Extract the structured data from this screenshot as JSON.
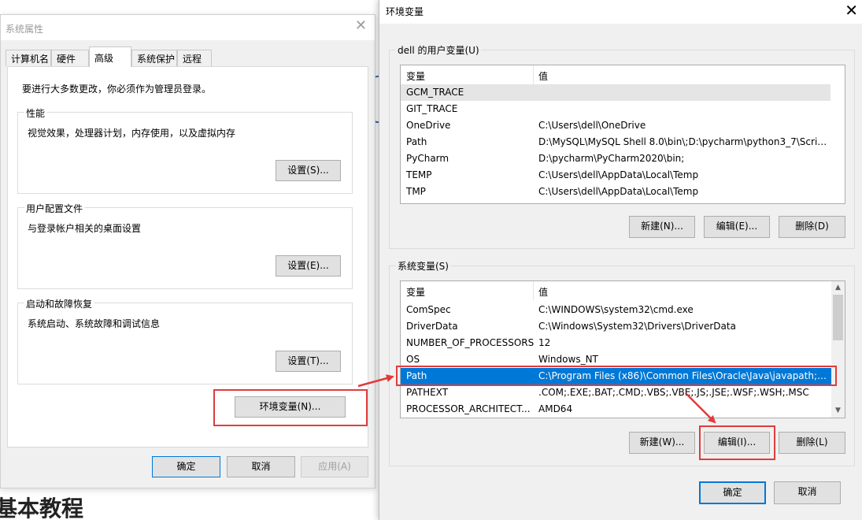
{
  "background": {
    "heading": "基本教程"
  },
  "system_properties": {
    "title": "系统属性",
    "tabs": [
      "计算机名",
      "硬件",
      "高级",
      "系统保护",
      "远程"
    ],
    "notice": "要进行大多数更改，你必须作为管理员登录。",
    "performance": {
      "title": "性能",
      "desc": "视觉效果，处理器计划，内存使用，以及虚拟内存",
      "button": "设置(S)..."
    },
    "user_profiles": {
      "title": "用户配置文件",
      "desc": "与登录帐户相关的桌面设置",
      "button": "设置(E)..."
    },
    "startup_recovery": {
      "title": "启动和故障恢复",
      "desc": "系统启动、系统故障和调试信息",
      "button": "设置(T)..."
    },
    "env_button": "环境变量(N)...",
    "ok": "确定",
    "cancel": "取消",
    "apply": "应用(A)"
  },
  "env_vars": {
    "title": "环境变量",
    "user_section": {
      "title": "dell 的用户变量(U)",
      "col_var": "变量",
      "col_val": "值",
      "rows": [
        {
          "name": "GCM_TRACE",
          "value": ""
        },
        {
          "name": "GIT_TRACE",
          "value": ""
        },
        {
          "name": "OneDrive",
          "value": "C:\\Users\\dell\\OneDrive"
        },
        {
          "name": "Path",
          "value": "D:\\MySQL\\MySQL Shell 8.0\\bin\\;D:\\pycharm\\python3_7\\Script..."
        },
        {
          "name": "PyCharm",
          "value": "D:\\pycharm\\PyCharm2020\\bin;"
        },
        {
          "name": "TEMP",
          "value": "C:\\Users\\dell\\AppData\\Local\\Temp"
        },
        {
          "name": "TMP",
          "value": "C:\\Users\\dell\\AppData\\Local\\Temp"
        }
      ],
      "new": "新建(N)...",
      "edit": "编辑(E)...",
      "delete": "删除(D)"
    },
    "system_section": {
      "title": "系统变量(S)",
      "col_var": "变量",
      "col_val": "值",
      "rows": [
        {
          "name": "ComSpec",
          "value": "C:\\WINDOWS\\system32\\cmd.exe"
        },
        {
          "name": "DriverData",
          "value": "C:\\Windows\\System32\\Drivers\\DriverData"
        },
        {
          "name": "NUMBER_OF_PROCESSORS",
          "value": "12"
        },
        {
          "name": "OS",
          "value": "Windows_NT"
        },
        {
          "name": "Path",
          "value": "C:\\Program Files (x86)\\Common Files\\Oracle\\Java\\javapath;C:..."
        },
        {
          "name": "PATHEXT",
          "value": ".COM;.EXE;.BAT;.CMD;.VBS;.VBE;.JS;.JSE;.WSF;.WSH;.MSC"
        },
        {
          "name": "PROCESSOR_ARCHITECT...",
          "value": "AMD64"
        }
      ],
      "new": "新建(W)...",
      "edit": "编辑(I)...",
      "delete": "删除(L)"
    },
    "ok": "确定",
    "cancel": "取消"
  },
  "colors": {
    "highlight": "#e03c3c",
    "selection": "#0078d7"
  }
}
